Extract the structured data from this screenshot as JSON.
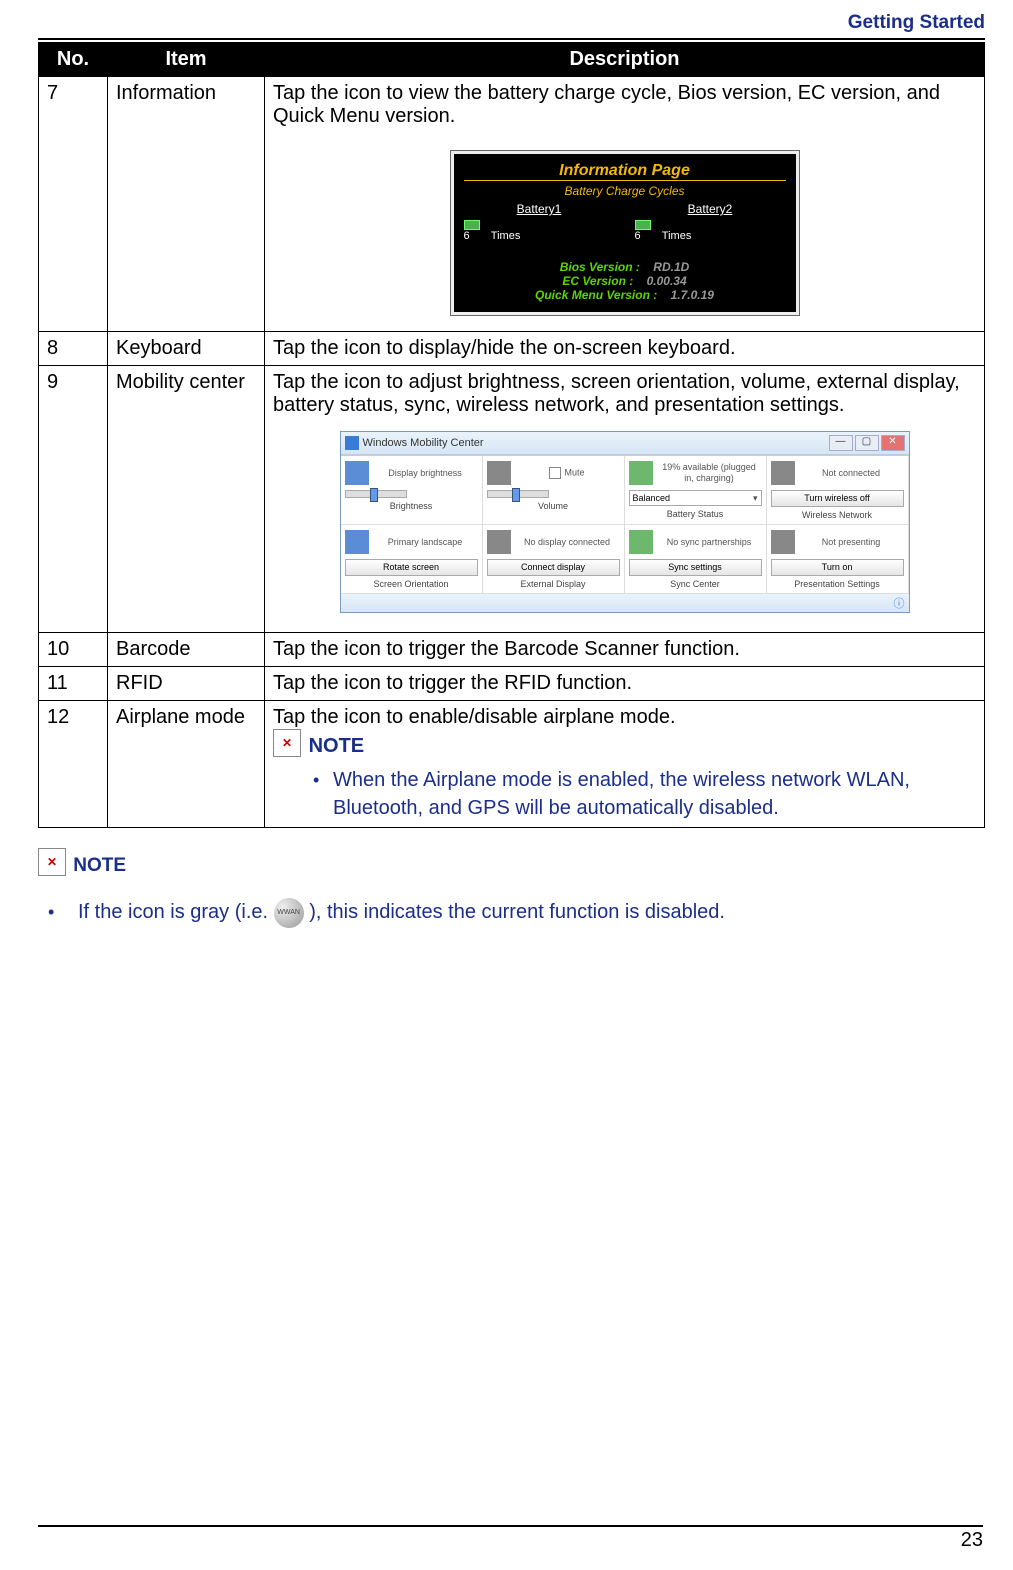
{
  "header": {
    "section": "Getting Started"
  },
  "table": {
    "head": {
      "no": "No.",
      "item": "Item",
      "desc": "Description"
    },
    "rows": {
      "r7": {
        "no": "7",
        "item": "Information",
        "desc": "Tap the icon to view the battery charge cycle, Bios version, EC version, and Quick Menu version."
      },
      "r8": {
        "no": "8",
        "item": "Keyboard",
        "desc": "Tap the icon to display/hide the on-screen keyboard."
      },
      "r9": {
        "no": "9",
        "item": "Mobility center",
        "desc": "Tap the icon to adjust brightness, screen orientation, volume, external display, battery status, sync, wireless network, and presentation settings."
      },
      "r10": {
        "no": "10",
        "item": "Barcode",
        "desc": "Tap the icon to trigger the Barcode Scanner function."
      },
      "r11": {
        "no": "11",
        "item": "RFID",
        "desc": "Tap the icon to trigger the RFID function."
      },
      "r12": {
        "no": "12",
        "item": "Airplane mode",
        "desc": "Tap the icon to enable/disable airplane mode.",
        "note_label": "NOTE",
        "note_bullet": "When the Airplane mode is enabled, the wireless network WLAN, Bluetooth, and GPS will be automatically disabled."
      }
    }
  },
  "info_shot": {
    "title": "Information Page",
    "subtitle": "Battery Charge Cycles",
    "bat1": {
      "name": "Battery1",
      "value": "6",
      "unit": "Times"
    },
    "bat2": {
      "name": "Battery2",
      "value": "6",
      "unit": "Times"
    },
    "bios_l": "Bios Version :",
    "bios_v": "RD.1D",
    "ec_l": "EC Version :",
    "ec_v": "0.00.34",
    "qm_l": "Quick Menu Version :",
    "qm_v": "1.7.0.19",
    "close": "✕"
  },
  "mob_shot": {
    "title": "Windows Mobility Center",
    "tiles": {
      "brightness": {
        "txt": "Display brightness",
        "label": "Brightness"
      },
      "volume": {
        "txt": "Mute",
        "label": "Volume"
      },
      "battery": {
        "txt": "19% available (plugged in, charging)",
        "combo": "Balanced",
        "label": "Battery Status"
      },
      "wireless": {
        "txt": "Not connected",
        "btn": "Turn wireless off",
        "label": "Wireless Network"
      },
      "orient": {
        "txt": "Primary landscape",
        "btn": "Rotate screen",
        "label": "Screen Orientation"
      },
      "extdisp": {
        "txt": "No display connected",
        "btn": "Connect display",
        "label": "External Display"
      },
      "sync": {
        "txt": "No sync partnerships",
        "btn": "Sync settings",
        "label": "Sync Center"
      },
      "present": {
        "txt": "Not presenting",
        "btn": "Turn on",
        "label": "Presentation Settings"
      }
    },
    "min": "—",
    "max": "▢",
    "close": "✕"
  },
  "page_note": {
    "label": "NOTE",
    "text_before": "If the icon is gray (i.e. ",
    "text_after": "), this indicates the current function is disabled."
  },
  "footer": {
    "page": "23"
  }
}
